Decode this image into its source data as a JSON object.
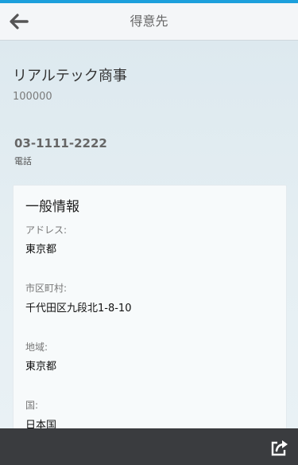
{
  "header": {
    "title": "得意先",
    "back_icon": "arrow-left-icon"
  },
  "account": {
    "name": "リアルテック商事",
    "number": "100000",
    "phone": "03-1111-2222",
    "phone_label": "電話"
  },
  "general_info": {
    "title": "一般情報",
    "fields": [
      {
        "label": "アドレス:",
        "value": "東京都"
      },
      {
        "label": "市区町村:",
        "value": "千代田区九段北1-8-10"
      },
      {
        "label": "地域:",
        "value": "東京都"
      },
      {
        "label": "国:",
        "value": "日本国"
      }
    ]
  },
  "footer": {
    "share_icon": "share-icon"
  },
  "colors": {
    "accent": "#1b9fdc",
    "footer_bg": "#3a3c3f",
    "header_bg": "#f4f6f8"
  }
}
